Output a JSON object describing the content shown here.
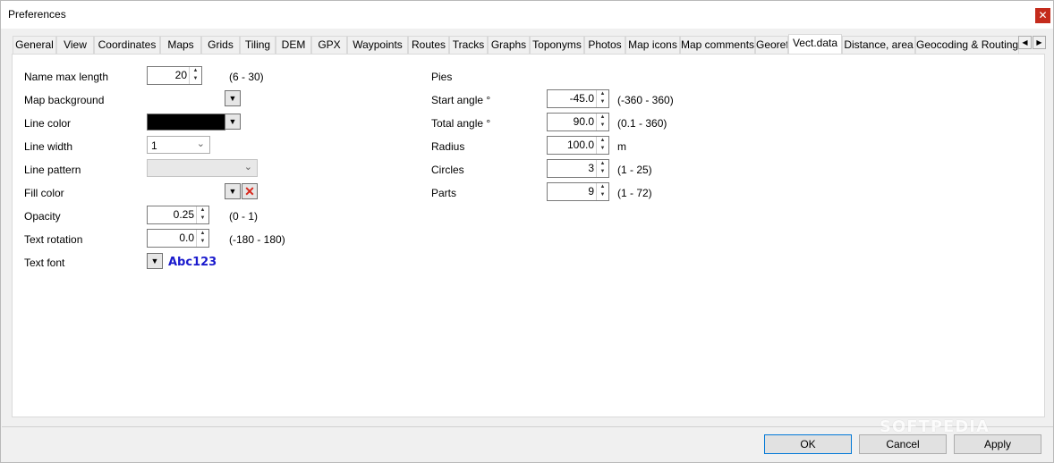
{
  "window": {
    "title": "Preferences",
    "close_glyph": "✕"
  },
  "tabs": [
    {
      "label": "General"
    },
    {
      "label": "View"
    },
    {
      "label": "Coordinates"
    },
    {
      "label": "Maps"
    },
    {
      "label": "Grids"
    },
    {
      "label": "Tiling"
    },
    {
      "label": "DEM"
    },
    {
      "label": "GPX"
    },
    {
      "label": "Waypoints"
    },
    {
      "label": "Routes"
    },
    {
      "label": "Tracks"
    },
    {
      "label": "Graphs"
    },
    {
      "label": "Toponyms"
    },
    {
      "label": "Photos"
    },
    {
      "label": "Map icons"
    },
    {
      "label": "Map comments"
    },
    {
      "label": "Georef."
    },
    {
      "label": "Vect.data",
      "active": true
    },
    {
      "label": "Distance, area"
    },
    {
      "label": "Geocoding & Routing"
    }
  ],
  "tab_scroll": {
    "left": "◀",
    "right": "▶"
  },
  "left": {
    "name_max_length": {
      "label": "Name max length",
      "value": "20",
      "range": "(6 - 30)"
    },
    "map_background": {
      "label": "Map background"
    },
    "line_color": {
      "label": "Line color",
      "color": "#000000"
    },
    "line_width": {
      "label": "Line width",
      "value": "1"
    },
    "line_pattern": {
      "label": "Line pattern",
      "value": ""
    },
    "fill_color": {
      "label": "Fill color"
    },
    "opacity": {
      "label": "Opacity",
      "value": "0.25",
      "range": "(0 - 1)"
    },
    "text_rotation": {
      "label": "Text rotation",
      "value": "0.0",
      "range": "(-180 - 180)"
    },
    "text_font": {
      "label": "Text font",
      "sample": "Abc123",
      "sample_color": "#1a1acd"
    }
  },
  "pies": {
    "heading": "Pies",
    "start_angle": {
      "label": "Start angle °",
      "value": "-45.0",
      "range": "(-360 - 360)"
    },
    "total_angle": {
      "label": "Total angle °",
      "value": "90.0",
      "range": "(0.1 - 360)"
    },
    "radius": {
      "label": "Radius",
      "value": "100.0",
      "unit": "m"
    },
    "circles": {
      "label": "Circles",
      "value": "3",
      "range": "(1 - 25)"
    },
    "parts": {
      "label": "Parts",
      "value": "9",
      "range": "(1 - 72)"
    }
  },
  "buttons": {
    "ok": "OK",
    "cancel": "Cancel",
    "apply": "Apply"
  },
  "watermark": "SOFTPEDIA"
}
